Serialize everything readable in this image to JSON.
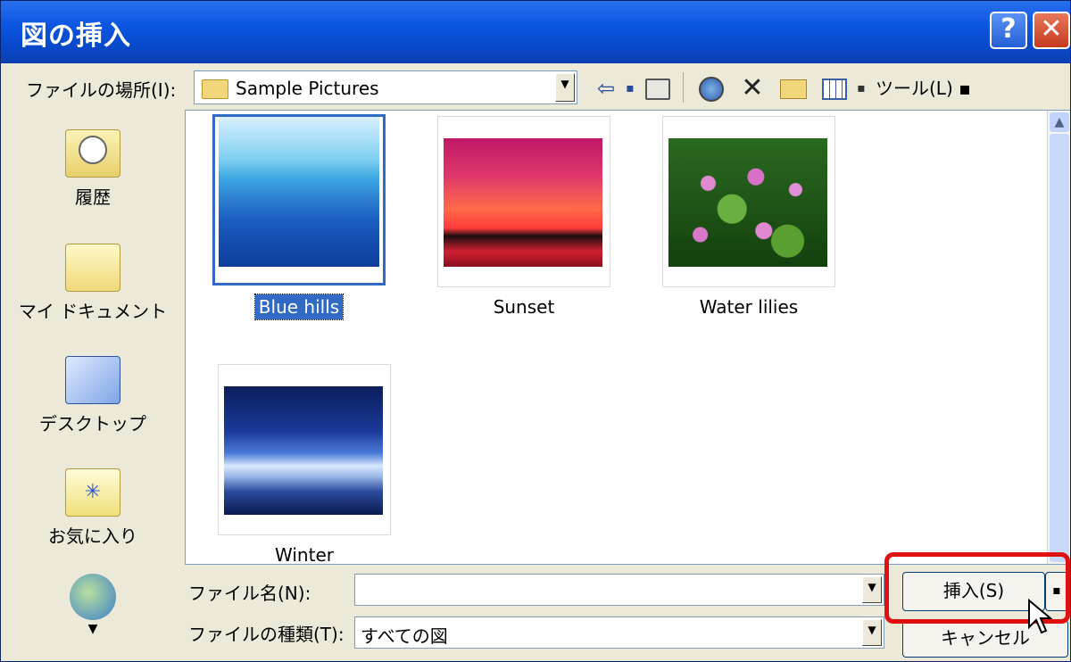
{
  "window": {
    "title": "図の挿入",
    "help_btn": "?",
    "close_btn": "✕"
  },
  "toolbar": {
    "location_label": "ファイルの場所(I):",
    "location_value": "Sample Pictures",
    "back_icon": "back-arrow-icon",
    "up_icon": "up-folder-icon",
    "search_web_icon": "search-web-icon",
    "delete_icon": "delete-icon",
    "new_folder_icon": "new-folder-icon",
    "views_icon": "views-icon",
    "tools_label": "ツール(L)"
  },
  "places": [
    {
      "label": "履歴",
      "icon": "history-icon"
    },
    {
      "label": "マイ ドキュメント",
      "icon": "my-documents-icon"
    },
    {
      "label": "デスクトップ",
      "icon": "desktop-icon"
    },
    {
      "label": "お気に入り",
      "icon": "favorites-icon"
    },
    {
      "label": "",
      "icon": "network-places-icon"
    }
  ],
  "files": [
    {
      "name": "Blue hills",
      "selected": true
    },
    {
      "name": "Sunset",
      "selected": false
    },
    {
      "name": "Water lilies",
      "selected": false
    },
    {
      "name": "Winter",
      "selected": false
    }
  ],
  "filename": {
    "label": "ファイル名(N):",
    "value": ""
  },
  "filetype": {
    "label": "ファイルの種類(T):",
    "value": "すべての図"
  },
  "buttons": {
    "insert": "挿入(S)",
    "cancel": "キャンセル"
  },
  "colors": {
    "title_bar": "#0b55e0",
    "selection": "#316ac5",
    "highlight_box": "#e01010"
  }
}
